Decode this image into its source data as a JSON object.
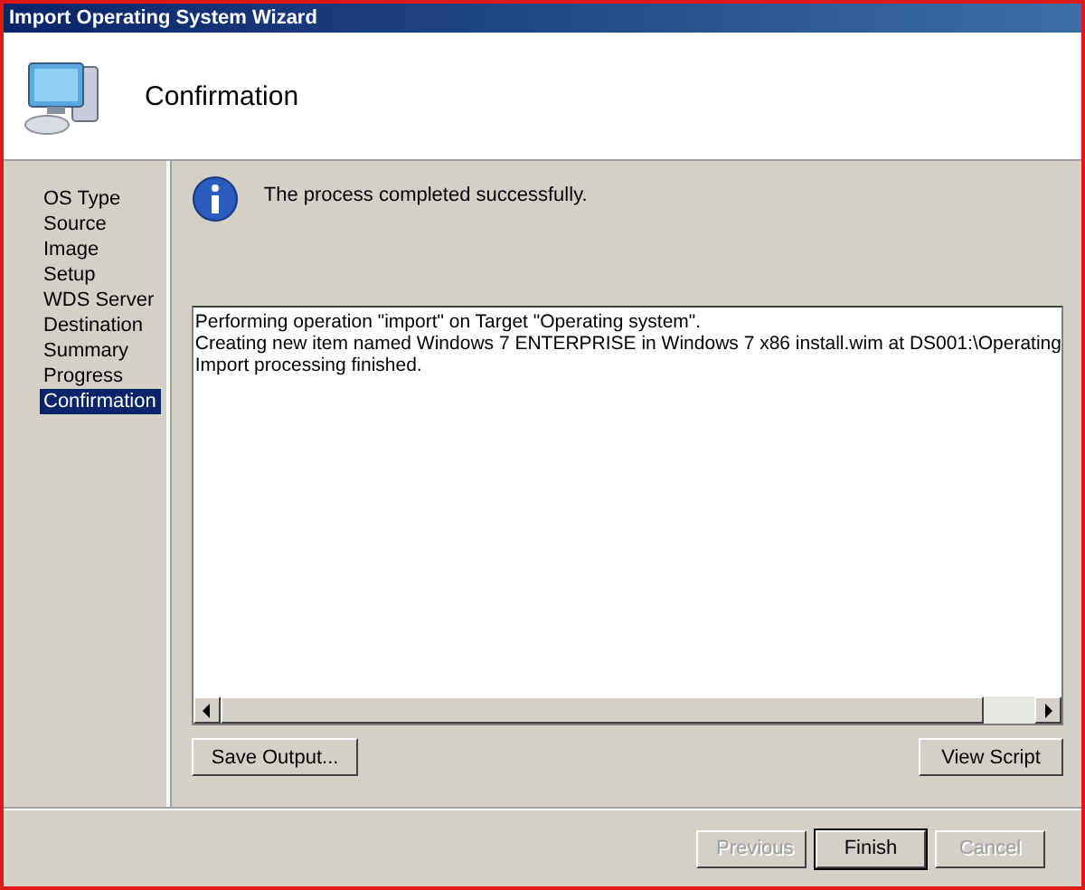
{
  "window": {
    "title": "Import Operating System Wizard"
  },
  "header": {
    "title": "Confirmation"
  },
  "steps": [
    {
      "label": "OS Type",
      "selected": false
    },
    {
      "label": "Source",
      "selected": false
    },
    {
      "label": "Image",
      "selected": false
    },
    {
      "label": "Setup",
      "selected": false
    },
    {
      "label": "WDS Server",
      "selected": false
    },
    {
      "label": "Destination",
      "selected": false
    },
    {
      "label": "Summary",
      "selected": false
    },
    {
      "label": "Progress",
      "selected": false
    },
    {
      "label": "Confirmation",
      "selected": true
    }
  ],
  "message": "The process completed successfully.",
  "output_lines": [
    "Performing operation \"import\" on Target \"Operating system\".",
    "Creating new item named Windows 7 ENTERPRISE in Windows 7 x86 install.wim at DS001:\\Operating",
    "Import processing finished."
  ],
  "output_buttons": [
    {
      "label": "Save Output..."
    },
    {
      "label": "View Script"
    }
  ],
  "footer_buttons": [
    {
      "label": "Previous",
      "disabled": true
    },
    {
      "label": "Finish",
      "disabled": false
    },
    {
      "label": "Cancel",
      "disabled": true
    }
  ]
}
